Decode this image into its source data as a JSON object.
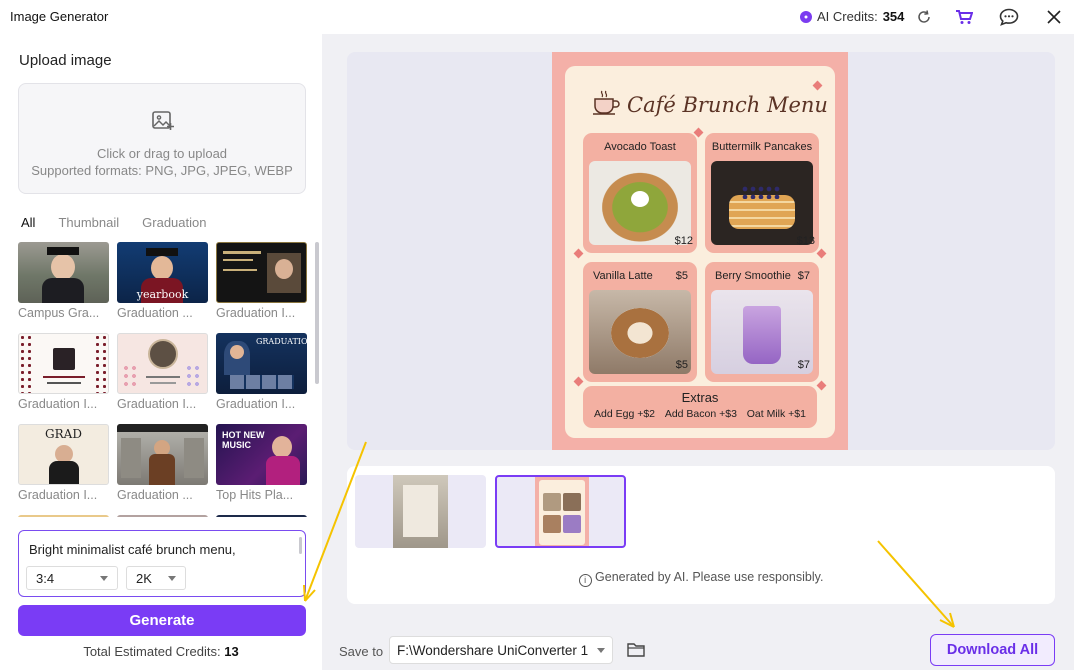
{
  "app": {
    "title": "Image Generator"
  },
  "header": {
    "credits_label": "AI Credits:",
    "credits_value": "354"
  },
  "upload": {
    "title": "Upload image",
    "hint_line1": "Click or drag to upload",
    "hint_line2": "Supported formats: PNG, JPG, JPEG, WEBP"
  },
  "tabs": [
    {
      "label": "All",
      "active": true
    },
    {
      "label": "Thumbnail",
      "active": false
    },
    {
      "label": "Graduation",
      "active": false
    }
  ],
  "templates": [
    {
      "caption": "Campus Gra..."
    },
    {
      "caption": "Graduation ...",
      "overlay": "yearbook"
    },
    {
      "caption": "Graduation I..."
    },
    {
      "caption": "Graduation I..."
    },
    {
      "caption": "Graduation I..."
    },
    {
      "caption": "Graduation I...",
      "overlay": "GRADUATION"
    },
    {
      "caption": "Graduation I...",
      "overlay": "GRAD"
    },
    {
      "caption": "Graduation ..."
    },
    {
      "caption": "Top Hits Pla...",
      "overlay": "HOT NEW MUSIC"
    }
  ],
  "prompt": {
    "text": "Bright minimalist café brunch menu,",
    "ratio": "3:4",
    "resolution": "2K"
  },
  "generate_label": "Generate",
  "estimate": {
    "label": "Total Estimated Credits:",
    "value": "13"
  },
  "poster": {
    "title": "Café Brunch Menu",
    "items": [
      {
        "name": "Avocado Toast",
        "price": "$12"
      },
      {
        "name": "Buttermilk Pancakes",
        "price": "$13"
      },
      {
        "name": "Vanilla Latte",
        "price": "$5"
      },
      {
        "name": "Berry Smoothie",
        "price": "$7"
      }
    ],
    "extras_title": "Extras",
    "extras": [
      "Add Egg +$2",
      "Add Bacon +$3",
      "Oat Milk +$1"
    ]
  },
  "notice": "Generated by AI. Please use responsibly.",
  "footer": {
    "save_to_label": "Save to",
    "save_path": "F:\\Wondershare UniConverter 1",
    "download_label": "Download All"
  },
  "colors": {
    "accent": "#7a3cf5",
    "poster_bg": "#f4b0a8",
    "annotation_arrow": "#f5c300"
  }
}
